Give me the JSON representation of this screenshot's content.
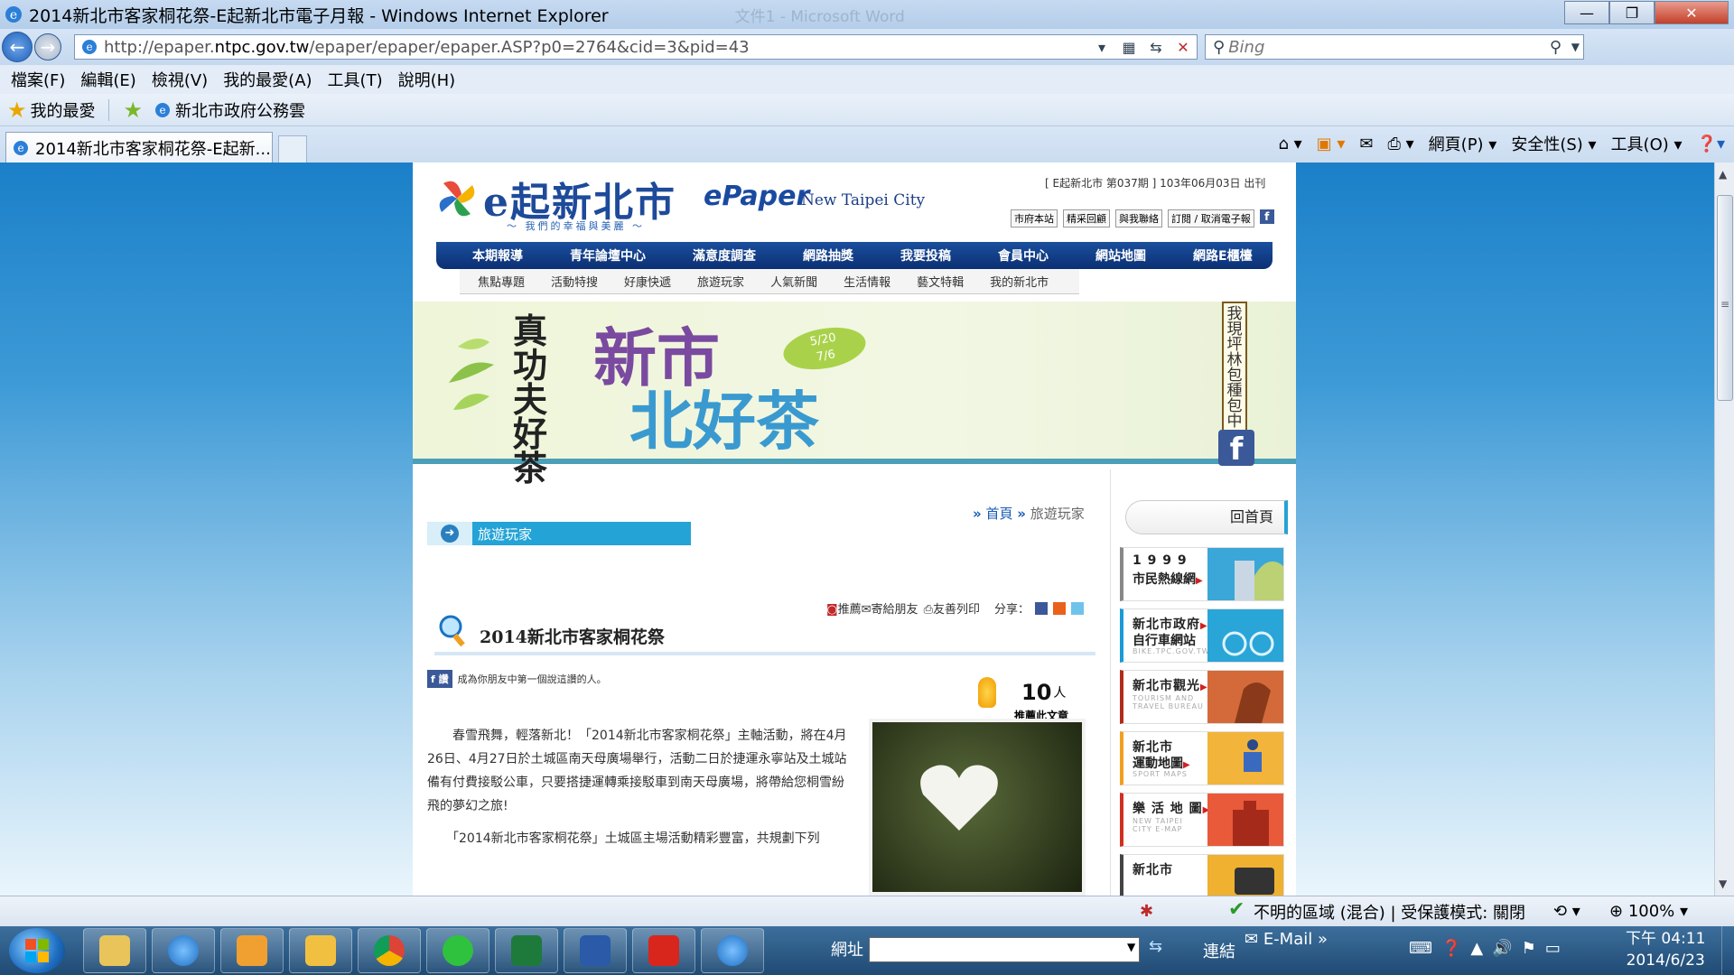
{
  "window": {
    "title": "2014新北市客家桐花祭-E起新北市電子月報 - Windows Internet Explorer",
    "ghost_title": "文件1 - Microsoft Word",
    "minimize": "—",
    "maximize": "❐",
    "close": "✕"
  },
  "address_bar": {
    "url_prefix": "http://epaper.",
    "url_domain": "ntpc.gov.tw",
    "url_suffix": "/epaper/epaper/epaper.ASP?p0=2764&cid=3&pid=43",
    "search_placeholder": "Bing"
  },
  "menu": [
    "檔案(F)",
    "編輯(E)",
    "檢視(V)",
    "我的最愛(A)",
    "工具(T)",
    "說明(H)"
  ],
  "favorites_bar": {
    "favorites_label": "我的最愛",
    "item": "新北市政府公務雲"
  },
  "tab": {
    "title": "2014新北市客家桐花祭-E起新..."
  },
  "command_bar": {
    "page": "網頁(P) ▾",
    "safety": "安全性(S) ▾",
    "tools": "工具(O) ▾"
  },
  "site": {
    "logo_text": "e起新北市",
    "slogan": "～ 我們的幸福與美麗 ～",
    "epaper": "ePaper",
    "city": "New Taipei City",
    "issue": "[ E起新北市 第037期 ] 103年06月03日 出刊",
    "header_links": [
      "市府本站",
      "精采回顧",
      "與我聯絡",
      "訂閱 / 取消電子報"
    ],
    "fb": "f",
    "main_nav": [
      "本期報導",
      "青年論壇中心",
      "滿意度調查",
      "網路抽獎",
      "我要投稿",
      "會員中心",
      "網站地圖",
      "網路E櫃檯"
    ],
    "sub_nav": [
      "焦點專題",
      "活動特搜",
      "好康快遞",
      "旅遊玩家",
      "人氣新聞",
      "生活情報",
      "藝文特輯",
      "我的新北市"
    ],
    "banner": {
      "vertical": "真功夫好茶",
      "title_line1": "新市",
      "title_line2": "北好茶",
      "dates": "5/20\n7/6",
      "side_text": "我現坪林包種包中"
    }
  },
  "article": {
    "breadcrumb_arrow": "»",
    "breadcrumb_home": "首頁",
    "breadcrumb_current": "旅遊玩家",
    "section": "旅遊玩家",
    "tools": "推薦",
    "tool_mail": "寄給朋友",
    "tool_print": "友善列印",
    "share": "分享：",
    "title": "2014新北市客家桐花祭",
    "fb_button": "讚",
    "fb_text": "成為你朋友中第一個說這讚的人。",
    "likes": "10",
    "likes_unit": "人",
    "likes_caption": "推薦此文章",
    "para1": "　　春雪飛舞，輕落新北！「2014新北市客家桐花祭」主軸活動，將在4月26日、4月27日於土城區南天母廣場舉行，活動二日於捷運永寧站及土城站備有付費接駁公車，只要搭捷運轉乘接駁車到南天母廣場，將帶給您桐雪紛飛的夢幻之旅!",
    "para2": "　　「2014新北市客家桐花祭」土城區主場活動精彩豐富，共規劃下列"
  },
  "sidebar": {
    "home": "回首頁",
    "tiles": [
      {
        "l1": "1 9 9 9",
        "l2": "市民熱線網",
        "l3": ""
      },
      {
        "l1": "新北市政府",
        "l2": "自行車網站",
        "l3": "BIKE.TPC.GOV.TW"
      },
      {
        "l1": "新北市觀光",
        "l2": "",
        "l3": "TOURISM AND TRAVEL BUREAU"
      },
      {
        "l1": "新北市",
        "l2": "運動地圖",
        "l3": "SPORT MAPS"
      },
      {
        "l1": "樂 活 地 圖",
        "l2": "",
        "l3": "NEW TAIPEI CITY E-MAP"
      },
      {
        "l1": "新北市",
        "l2": "",
        "l3": ""
      }
    ]
  },
  "status_bar": {
    "zone": "不明的區域 (混合) | 受保護模式: 關閉",
    "zoom": "100%"
  },
  "taskbar": {
    "address_label": "網址",
    "links": "連結",
    "email": "E-Mail",
    "time": "下午 04:11",
    "date": "2014/6/23"
  },
  "colors": {
    "nav_blue": "#0b2f73",
    "accent_cyan": "#23a3d6",
    "page_bg_top": "#1b80c9"
  }
}
